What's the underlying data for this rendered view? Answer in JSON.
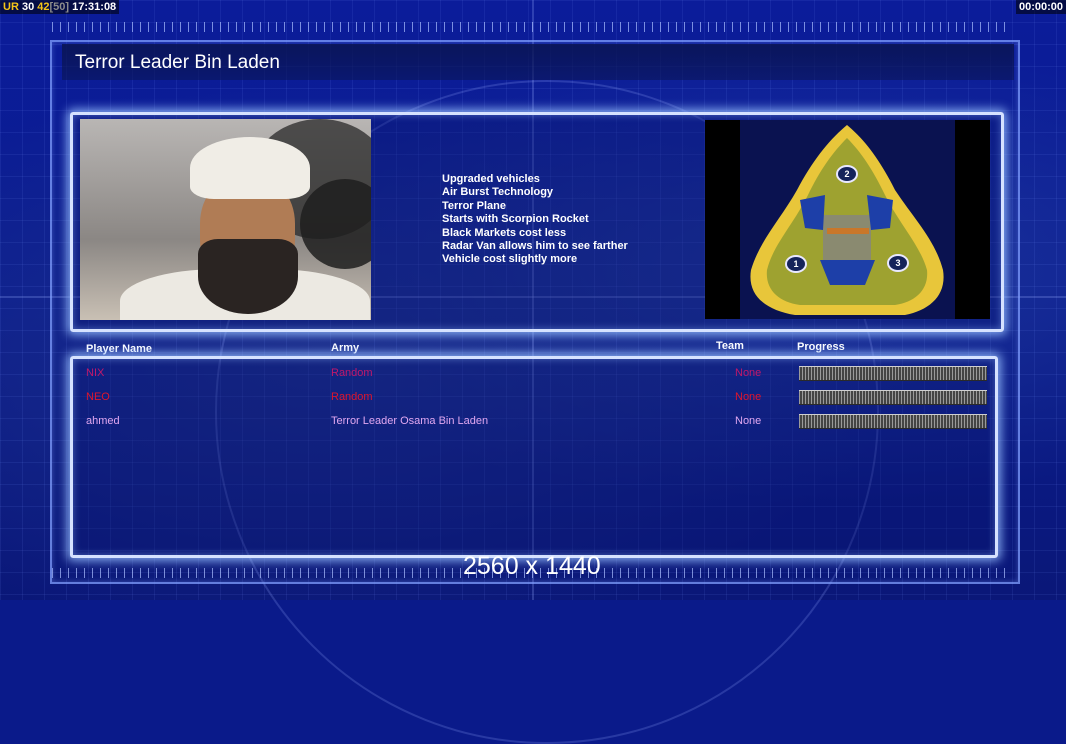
{
  "hud": {
    "left_prefix": "UR",
    "value_a": "30",
    "value_b": "42",
    "value_c": "[50]",
    "clock": "17:31:08",
    "timer": "00:00:00"
  },
  "screen": {
    "title": "Terror Leader Bin Laden",
    "resolution_label": "2560 x 1440"
  },
  "general": {
    "features": [
      "Upgraded vehicles",
      "Air Burst Technology",
      "Terror Plane",
      "Starts with Scorpion Rocket",
      "Black Markets cost less",
      "Radar Van allows him to see farther",
      "Vehicle cost slightly more"
    ]
  },
  "minimap": {
    "start_positions": [
      "1",
      "2",
      "3"
    ]
  },
  "players_table": {
    "headers": {
      "name": "Player Name",
      "army": "Army",
      "team": "Team",
      "progress": "Progress"
    },
    "rows": [
      {
        "name": "NIX",
        "army": "Random",
        "team": "None",
        "color": "#c2186a"
      },
      {
        "name": "NEO",
        "army": "Random",
        "team": "None",
        "color": "#e0152c"
      },
      {
        "name": "ahmed",
        "army": "Terror Leader Osama Bin Laden",
        "team": "None",
        "color": "#e0a7f0"
      }
    ]
  },
  "colors": {
    "hud_yellow": "#f5c518",
    "panel_glow": "#d6e2ff",
    "background": "#0a1a8a"
  }
}
